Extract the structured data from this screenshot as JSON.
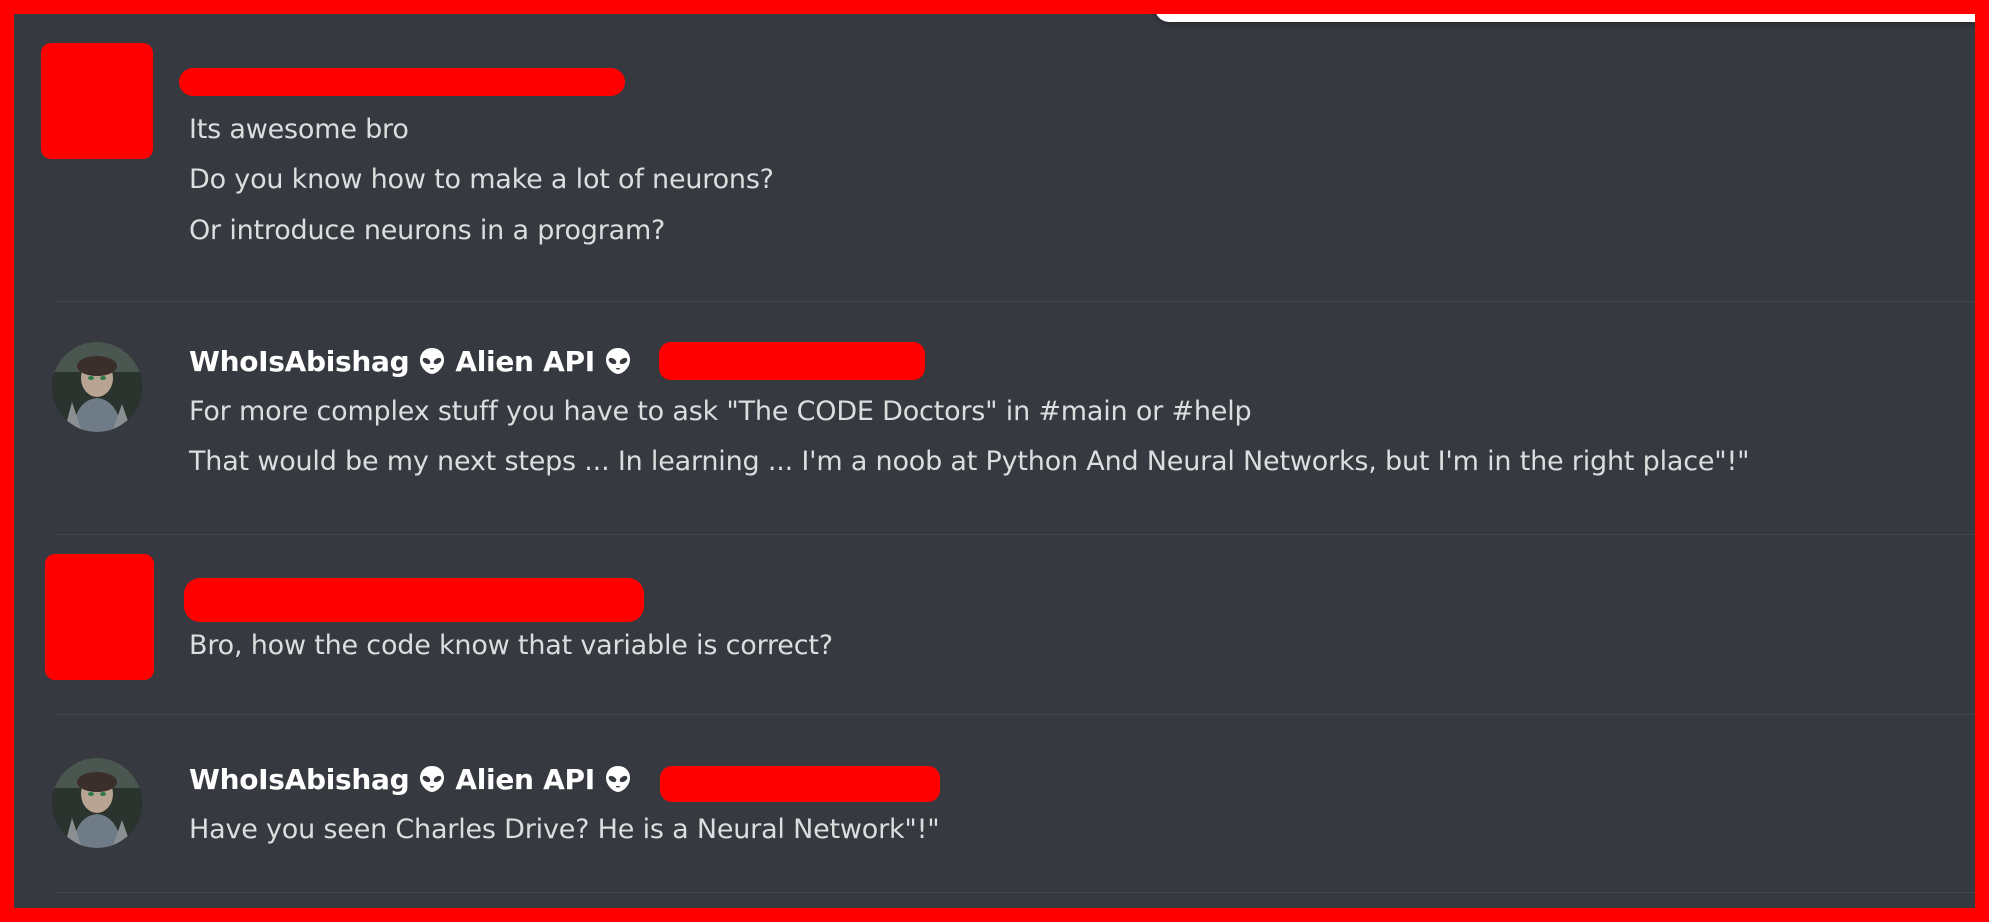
{
  "messages": [
    {
      "author": "",
      "author_redacted": true,
      "lines": [
        "Its awesome bro",
        "Do you know how to make a lot of neurons?",
        "Or introduce neurons in a program?"
      ]
    },
    {
      "author": "WhoIsAbishag",
      "tag": "Alien API",
      "lines": [
        "For more complex stuff you have to ask \"The CODE Doctors\" in #main or #help",
        "That would be my next steps ... In learning ... I'm a noob at Python And Neural Networks, but I'm in the right place\"!\""
      ]
    },
    {
      "author": "",
      "author_redacted": true,
      "lines": [
        "Bro, how the code know that variable is correct?"
      ]
    },
    {
      "author": "WhoIsAbishag",
      "tag": "Alien API",
      "lines": [
        "Have you seen Charles Drive? He is a Neural Network\"!\""
      ]
    }
  ],
  "icons": {
    "alien": "alien-emoji-icon"
  },
  "colors": {
    "background": "#36393f",
    "redaction": "#ff0000",
    "username": "#ffffff",
    "text": "#dcddde"
  }
}
